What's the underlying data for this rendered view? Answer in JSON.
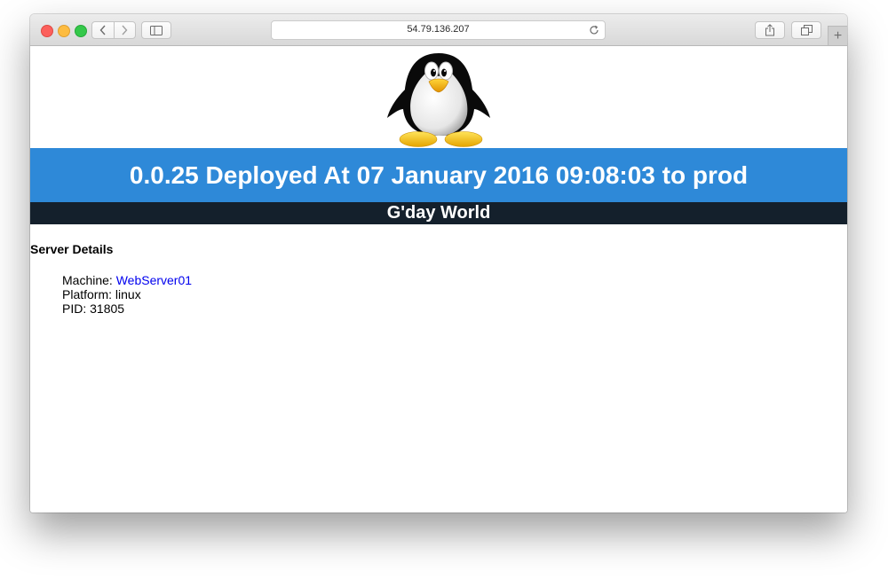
{
  "browser": {
    "address": "54.79.136.207",
    "new_tab_label": "+"
  },
  "page": {
    "logo_icon": "tux-penguin-icon",
    "deploy_banner": "0.0.25 Deployed At 07 January 2016 09:08:03 to prod",
    "greeting": "G'day World",
    "section_heading": "Server Details",
    "details": {
      "machine_label": "Machine: ",
      "machine_value": "WebServer01",
      "platform": "Platform: linux",
      "pid": "PID: 31805"
    }
  },
  "colors": {
    "banner": "#2e89d8",
    "greeting_bar": "#14202c",
    "link": "#0000ee"
  }
}
